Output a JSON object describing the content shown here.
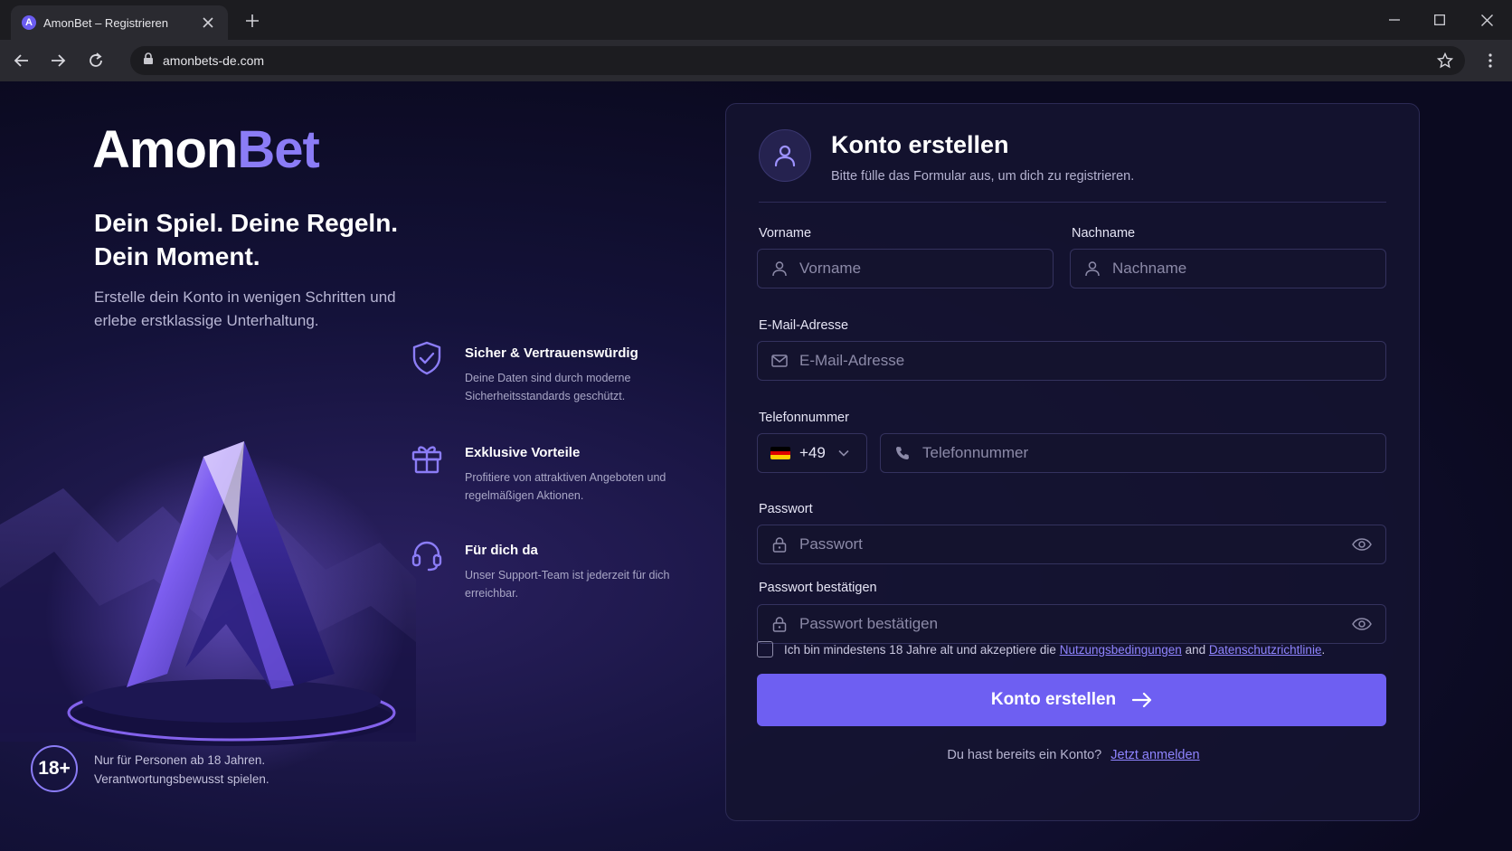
{
  "browser": {
    "tab_title": "AmonBet – Registrieren",
    "favicon_letter": "A",
    "url": "amonbets-de.com"
  },
  "brand": {
    "name_part1": "Amon",
    "name_part2": "Bet",
    "accent_color": "#8b7cf6",
    "button_color": "#6e5ff2"
  },
  "hero": {
    "headline_line1": "Dein Spiel. Deine Regeln.",
    "headline_line2": "Dein Moment.",
    "subline": "Erstelle dein Konto in wenigen Schritten und erlebe erstklassige Unterhaltung."
  },
  "features": [
    {
      "icon": "shield-check-icon",
      "title": "Sicher & Vertrauenswürdig",
      "desc": "Deine Daten sind durch moderne Sicherheitsstandards geschützt."
    },
    {
      "icon": "gift-icon",
      "title": "Exklusive Vorteile",
      "desc": "Profitiere von attraktiven Angeboten und regelmäßigen Aktionen."
    },
    {
      "icon": "headset-icon",
      "title": "Für dich da",
      "desc": "Unser Support-Team ist jederzeit für dich erreichbar."
    }
  ],
  "age": {
    "badge": "18+",
    "line1": "Nur für Personen ab 18 Jahren.",
    "line2": "Verantwortungsbewusst spielen."
  },
  "form": {
    "title": "Konto erstellen",
    "subtitle": "Bitte fülle das Formular aus, um dich zu registrieren.",
    "first_name": {
      "label": "Vorname",
      "placeholder": "Vorname",
      "value": ""
    },
    "last_name": {
      "label": "Nachname",
      "placeholder": "Nachname",
      "value": ""
    },
    "email": {
      "label": "E-Mail-Adresse",
      "placeholder": "E-Mail-Adresse",
      "value": ""
    },
    "phone": {
      "label": "Telefonnummer",
      "country_code": "+49",
      "placeholder": "Telefonnummer",
      "value": ""
    },
    "password": {
      "label": "Passwort",
      "placeholder": "Passwort",
      "value": ""
    },
    "password_confirm": {
      "label": "Passwort bestätigen",
      "placeholder": "Passwort bestätigen",
      "value": ""
    },
    "terms": {
      "prefix": "Ich bin mindestens 18 Jahre alt und akzeptiere die",
      "link1": "Nutzungsbedingungen",
      "and": "and",
      "link2": "Datenschutzrichtlinie",
      "suffix": ".",
      "checked": false
    },
    "submit_label": "Konto erstellen",
    "login_prompt": "Du hast bereits ein Konto?",
    "login_link": "Jetzt anmelden"
  }
}
